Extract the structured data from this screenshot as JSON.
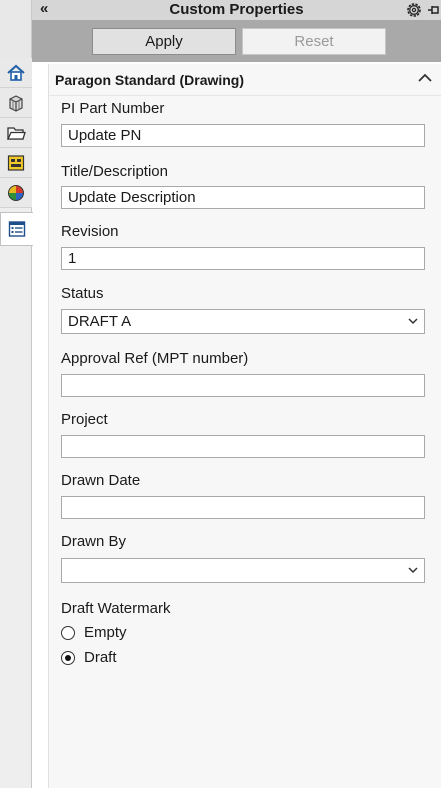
{
  "titlebar": {
    "title": "Custom Properties",
    "collapse_glyph": "«",
    "icons": [
      "chevron-double-left-icon",
      "gear-icon",
      "pin-icon"
    ]
  },
  "toolbar": {
    "apply_label": "Apply",
    "reset_label": "Reset",
    "reset_enabled": false
  },
  "side_tabs": [
    {
      "name": "home-icon"
    },
    {
      "name": "parts-library-icon"
    },
    {
      "name": "folder-icon"
    },
    {
      "name": "view-palette-icon"
    },
    {
      "name": "appearances-icon"
    },
    {
      "name": "custom-properties-icon",
      "active": true
    }
  ],
  "group": {
    "title": "Paragon Standard (Drawing)",
    "expanded": true
  },
  "fields": {
    "part_number": {
      "label": "PI Part Number",
      "value": "Update PN"
    },
    "title_description": {
      "label": "Title/Description",
      "value": "Update Description"
    },
    "revision": {
      "label": "Revision",
      "value": "1"
    },
    "status": {
      "label": "Status",
      "value": "DRAFT A"
    },
    "approval_ref": {
      "label": "Approval Ref (MPT number)",
      "value": ""
    },
    "project": {
      "label": "Project",
      "value": ""
    },
    "drawn_date": {
      "label": "Drawn Date",
      "value": ""
    },
    "drawn_by": {
      "label": "Drawn By",
      "value": ""
    }
  },
  "watermark": {
    "label": "Draft Watermark",
    "options": [
      "Empty",
      "Draft"
    ],
    "selected": "Draft"
  },
  "colors": {
    "toolbar_bg": "#a9a9a9",
    "titlebar_bg": "#d6d6d6",
    "panel_bg": "#f7f7f7"
  }
}
